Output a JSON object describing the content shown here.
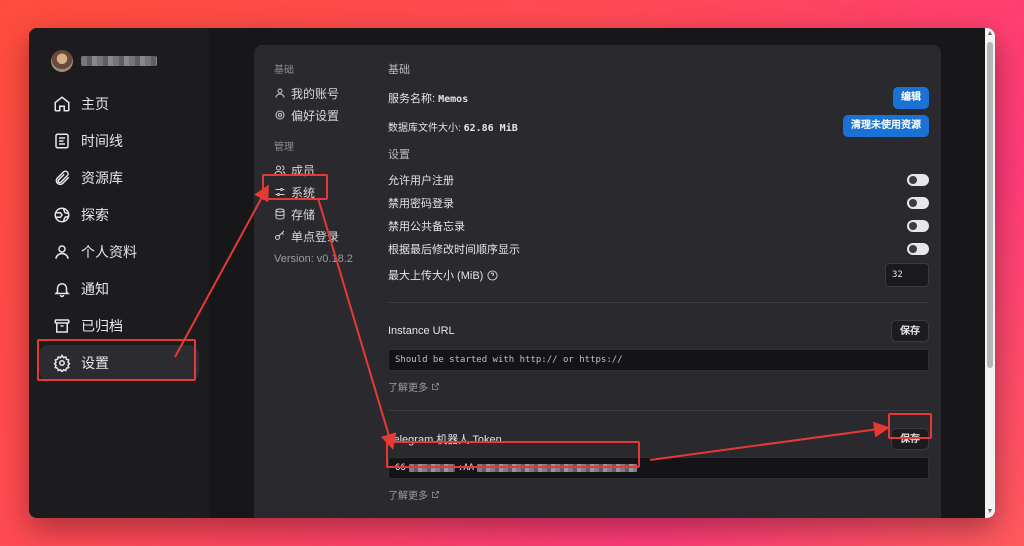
{
  "sidebar": {
    "items": [
      {
        "label": "主页",
        "icon": "home-icon"
      },
      {
        "label": "时间线",
        "icon": "timeline-icon"
      },
      {
        "label": "资源库",
        "icon": "paperclip-icon"
      },
      {
        "label": "探索",
        "icon": "compass-icon"
      },
      {
        "label": "个人资料",
        "icon": "user-icon"
      },
      {
        "label": "通知",
        "icon": "bell-icon"
      },
      {
        "label": "已归档",
        "icon": "archive-icon"
      },
      {
        "label": "设置",
        "icon": "gear-icon"
      }
    ]
  },
  "subnav": {
    "basic_head": "基础",
    "basic_items": [
      {
        "label": "我的账号",
        "icon": "user-icon"
      },
      {
        "label": "偏好设置",
        "icon": "gear-icon"
      }
    ],
    "admin_head": "管理",
    "admin_items": [
      {
        "label": "成员",
        "icon": "users-icon"
      },
      {
        "label": "系统",
        "icon": "sliders-icon"
      },
      {
        "label": "存储",
        "icon": "database-icon"
      },
      {
        "label": "单点登录",
        "icon": "key-icon"
      }
    ],
    "version": "Version: v0.18.2"
  },
  "main": {
    "basic_title": "基础",
    "service_name_label": "服务名称:",
    "service_name_value": "Memos",
    "edit_button": "编辑",
    "db_size_label": "数据库文件大小:",
    "db_size_value": "62.86 MiB",
    "clean_button": "清理未使用资源",
    "settings_title": "设置",
    "toggles": [
      {
        "label": "允许用户注册",
        "on": true
      },
      {
        "label": "禁用密码登录",
        "on": true
      },
      {
        "label": "禁用公共备忘录",
        "on": true
      },
      {
        "label": "根据最后修改时间顺序显示",
        "on": true
      }
    ],
    "max_upload_label": "最大上传大小 (MiB)",
    "max_upload_value": "32",
    "instance_url_label": "Instance URL",
    "instance_url_save": "保存",
    "instance_url_placeholder": "Should be started with http:// or https://",
    "learn_more_1": "了解更多",
    "telegram_label": "Telegram 机器人 Token",
    "telegram_save": "保存",
    "token_prefix": "66",
    "token_mid": ":AA",
    "learn_more_2": "了解更多"
  },
  "colors": {
    "accent": "#1a73d4",
    "annotation": "#e53935"
  }
}
